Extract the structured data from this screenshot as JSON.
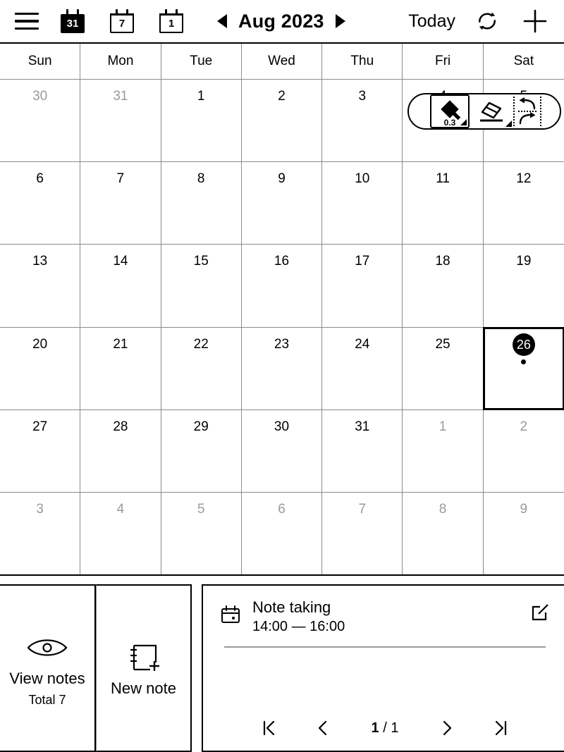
{
  "header": {
    "menu_icon": "hamburger-menu-icon",
    "view_buttons": [
      {
        "id": "month-view",
        "label": "31",
        "icon": "calendar-month-icon",
        "active": true
      },
      {
        "id": "week-view",
        "label": "7",
        "icon": "calendar-week-icon",
        "active": false
      },
      {
        "id": "day-view",
        "label": "1",
        "icon": "calendar-day-icon",
        "active": false
      }
    ],
    "prev_icon": "triangle-left-icon",
    "next_icon": "triangle-right-icon",
    "month_label": "Aug 2023",
    "today_label": "Today",
    "sync_icon": "sync-refresh-icon",
    "add_icon": "plus-icon"
  },
  "pen_toolbar": {
    "pen_icon": "marker-pen-icon",
    "pen_size": "0.3",
    "eraser_icon": "eraser-icon",
    "undo_icon": "undo-arrow-icon",
    "redo_icon": "redo-arrow-icon"
  },
  "calendar": {
    "weekdays": [
      "Sun",
      "Mon",
      "Tue",
      "Wed",
      "Thu",
      "Fri",
      "Sat"
    ],
    "weeks": [
      [
        {
          "day": "30",
          "muted": true,
          "selected": false,
          "has_event": false
        },
        {
          "day": "31",
          "muted": true,
          "selected": false,
          "has_event": false
        },
        {
          "day": "1",
          "muted": false,
          "selected": false,
          "has_event": false
        },
        {
          "day": "2",
          "muted": false,
          "selected": false,
          "has_event": false
        },
        {
          "day": "3",
          "muted": false,
          "selected": false,
          "has_event": false
        },
        {
          "day": "4",
          "muted": false,
          "selected": false,
          "has_event": false
        },
        {
          "day": "5",
          "muted": false,
          "selected": false,
          "has_event": false
        }
      ],
      [
        {
          "day": "6",
          "muted": false,
          "selected": false,
          "has_event": false
        },
        {
          "day": "7",
          "muted": false,
          "selected": false,
          "has_event": false
        },
        {
          "day": "8",
          "muted": false,
          "selected": false,
          "has_event": false
        },
        {
          "day": "9",
          "muted": false,
          "selected": false,
          "has_event": false
        },
        {
          "day": "10",
          "muted": false,
          "selected": false,
          "has_event": false
        },
        {
          "day": "11",
          "muted": false,
          "selected": false,
          "has_event": false
        },
        {
          "day": "12",
          "muted": false,
          "selected": false,
          "has_event": false
        }
      ],
      [
        {
          "day": "13",
          "muted": false,
          "selected": false,
          "has_event": false
        },
        {
          "day": "14",
          "muted": false,
          "selected": false,
          "has_event": false
        },
        {
          "day": "15",
          "muted": false,
          "selected": false,
          "has_event": false
        },
        {
          "day": "16",
          "muted": false,
          "selected": false,
          "has_event": false
        },
        {
          "day": "17",
          "muted": false,
          "selected": false,
          "has_event": false
        },
        {
          "day": "18",
          "muted": false,
          "selected": false,
          "has_event": false
        },
        {
          "day": "19",
          "muted": false,
          "selected": false,
          "has_event": false
        }
      ],
      [
        {
          "day": "20",
          "muted": false,
          "selected": false,
          "has_event": false
        },
        {
          "day": "21",
          "muted": false,
          "selected": false,
          "has_event": false
        },
        {
          "day": "22",
          "muted": false,
          "selected": false,
          "has_event": false
        },
        {
          "day": "23",
          "muted": false,
          "selected": false,
          "has_event": false
        },
        {
          "day": "24",
          "muted": false,
          "selected": false,
          "has_event": false
        },
        {
          "day": "25",
          "muted": false,
          "selected": false,
          "has_event": false
        },
        {
          "day": "26",
          "muted": false,
          "selected": true,
          "has_event": true
        }
      ],
      [
        {
          "day": "27",
          "muted": false,
          "selected": false,
          "has_event": false
        },
        {
          "day": "28",
          "muted": false,
          "selected": false,
          "has_event": false
        },
        {
          "day": "29",
          "muted": false,
          "selected": false,
          "has_event": false
        },
        {
          "day": "30",
          "muted": false,
          "selected": false,
          "has_event": false
        },
        {
          "day": "31",
          "muted": false,
          "selected": false,
          "has_event": false
        },
        {
          "day": "1",
          "muted": true,
          "selected": false,
          "has_event": false
        },
        {
          "day": "2",
          "muted": true,
          "selected": false,
          "has_event": false
        }
      ],
      [
        {
          "day": "3",
          "muted": true,
          "selected": false,
          "has_event": false
        },
        {
          "day": "4",
          "muted": true,
          "selected": false,
          "has_event": false
        },
        {
          "day": "5",
          "muted": true,
          "selected": false,
          "has_event": false
        },
        {
          "day": "6",
          "muted": true,
          "selected": false,
          "has_event": false
        },
        {
          "day": "7",
          "muted": true,
          "selected": false,
          "has_event": false
        },
        {
          "day": "8",
          "muted": true,
          "selected": false,
          "has_event": false
        },
        {
          "day": "9",
          "muted": true,
          "selected": false,
          "has_event": false
        }
      ]
    ]
  },
  "bottom": {
    "view_notes": {
      "icon": "eye-icon",
      "label": "View notes",
      "sub": "Total 7"
    },
    "new_note": {
      "icon": "new-note-icon",
      "label": "New note"
    },
    "note_card": {
      "calendar_icon": "calendar-event-icon",
      "title": "Note taking",
      "time": "14:00 — 16:00",
      "edit_icon": "edit-square-icon"
    },
    "pager": {
      "first_icon": "page-first-icon",
      "prev_icon": "page-prev-icon",
      "current": "1",
      "separator": " / ",
      "total": "1",
      "next_icon": "page-next-icon",
      "last_icon": "page-last-icon"
    }
  },
  "colors": {
    "ink": "#000000",
    "muted": "#9a9a9a",
    "grid": "#8a8a8a",
    "paper": "#ffffff"
  }
}
